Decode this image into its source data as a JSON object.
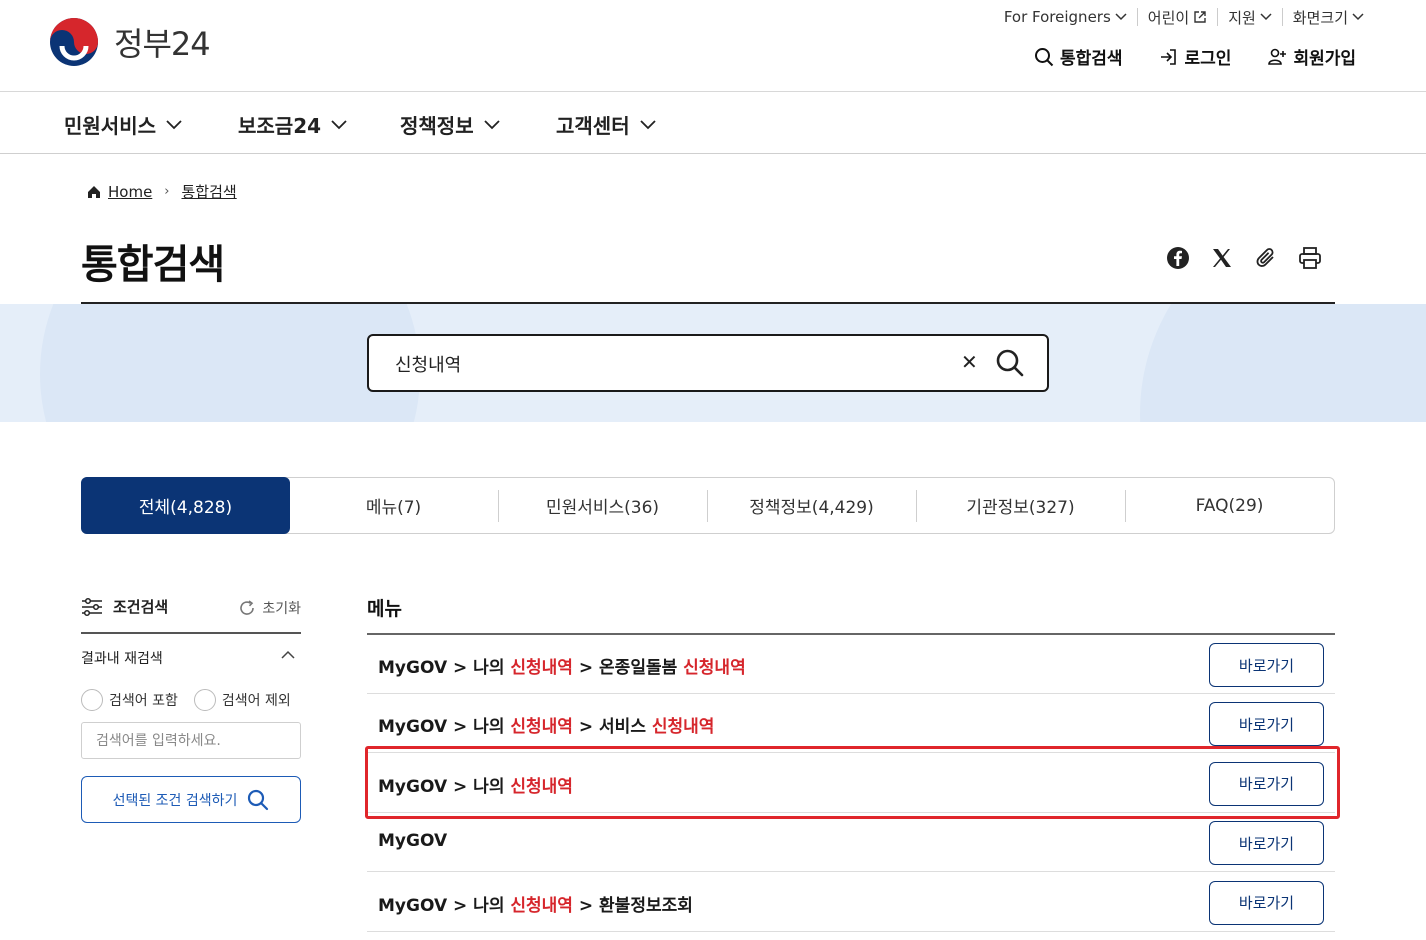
{
  "header": {
    "logo_text": "정부24",
    "util_links": [
      "For Foreigners",
      "어린이",
      "지원",
      "화면크기"
    ],
    "user_nav": [
      "통합검색",
      "로그인",
      "회원가입"
    ]
  },
  "gnb": [
    "민원서비스",
    "보조금24",
    "정책정보",
    "고객센터"
  ],
  "breadcrumb": {
    "home": "Home",
    "current": "통합검색"
  },
  "page_title": "통합검색",
  "share_icons": [
    "facebook-icon",
    "x-icon",
    "clip-icon",
    "print-icon"
  ],
  "search": {
    "value": "신청내역"
  },
  "tabs": [
    "전체(4,828)",
    "메뉴(7)",
    "민원서비스(36)",
    "정책정보(4,429)",
    "기관정보(327)",
    "FAQ(29)"
  ],
  "sidebar": {
    "title": "조건검색",
    "reset": "초기화",
    "sub_title": "결과내 재검색",
    "radio_include": "검색어 포함",
    "radio_exclude": "검색어 제외",
    "input_placeholder": "검색어를 입력하세요.",
    "search_button": "선택된 조건 검색하기"
  },
  "results": {
    "section_title": "메뉴",
    "button_label": "바로가기",
    "rows": [
      {
        "parts": [
          [
            "MyGOV > 나의 ",
            false
          ],
          [
            "신청내역",
            true
          ],
          [
            " > 온종일돌봄 ",
            false
          ],
          [
            "신청내역",
            true
          ]
        ]
      },
      {
        "parts": [
          [
            "MyGOV > 나의 ",
            false
          ],
          [
            "신청내역",
            true
          ],
          [
            " > 서비스 ",
            false
          ],
          [
            "신청내역",
            true
          ]
        ]
      },
      {
        "parts": [
          [
            "MyGOV > 나의 ",
            false
          ],
          [
            "신청내역",
            true
          ]
        ]
      },
      {
        "parts": [
          [
            "MyGOV",
            false
          ]
        ]
      },
      {
        "parts": [
          [
            "MyGOV > 나의 ",
            false
          ],
          [
            "신청내역",
            true
          ],
          [
            " > 환불정보조회",
            false
          ]
        ]
      }
    ]
  },
  "colors": {
    "primary": "#0b3475",
    "highlight_text": "#d6262c",
    "annotation": "#e0262b",
    "banner": "#e5eef9"
  }
}
